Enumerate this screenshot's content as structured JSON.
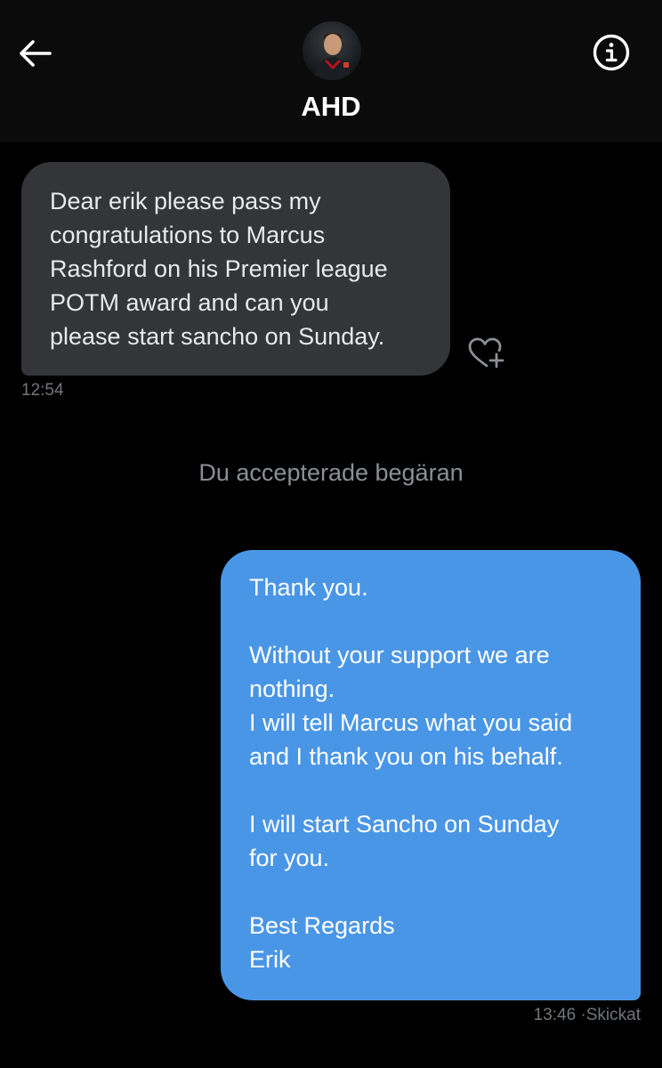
{
  "header": {
    "contact_name": "AHD",
    "back_icon": "arrow-left-icon",
    "info_icon": "info-circle-icon",
    "avatar_icon": "avatar"
  },
  "messages": {
    "received": {
      "lines": [
        "Dear erik please pass my",
        "congratulations to Marcus",
        "Rashford on his Premier league",
        "POTM award and can you",
        "please start sancho on Sunday."
      ],
      "time": "12:54",
      "react_icon": "heart-plus-icon"
    },
    "system_note": "Du accepterade begäran",
    "sent": {
      "lines": [
        "Thank you.",
        "",
        "Without your support we are",
        "nothing.",
        "I will tell Marcus what you said",
        "and I thank you on his behalf.",
        "",
        "I will start Sancho on Sunday",
        "for you.",
        "",
        "Best Regards",
        "Erik"
      ],
      "time": "13:46",
      "status": "Skickat",
      "separator": "·"
    }
  },
  "colors": {
    "background": "#000000",
    "header_bg": "#0b0b0b",
    "received_bubble": "#333538",
    "sent_bubble": "#4a96e6",
    "muted_text": "#71767b"
  }
}
